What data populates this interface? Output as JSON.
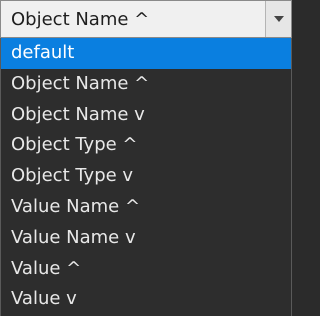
{
  "select": {
    "value": "Object Name ^",
    "button_icon": "chevron-down-icon"
  },
  "options": [
    {
      "label": "default",
      "selected": true
    },
    {
      "label": "Object Name ^",
      "selected": false
    },
    {
      "label": "Object Name v",
      "selected": false
    },
    {
      "label": "Object Type ^",
      "selected": false
    },
    {
      "label": "Object Type v",
      "selected": false
    },
    {
      "label": "Value Name ^",
      "selected": false
    },
    {
      "label": "Value Name v",
      "selected": false
    },
    {
      "label": "Value ^",
      "selected": false
    },
    {
      "label": "Value v",
      "selected": false
    }
  ],
  "colors": {
    "selected_bg": "#0a7fe0",
    "list_bg": "#2d2d2d",
    "text": "#e8e8e8"
  }
}
